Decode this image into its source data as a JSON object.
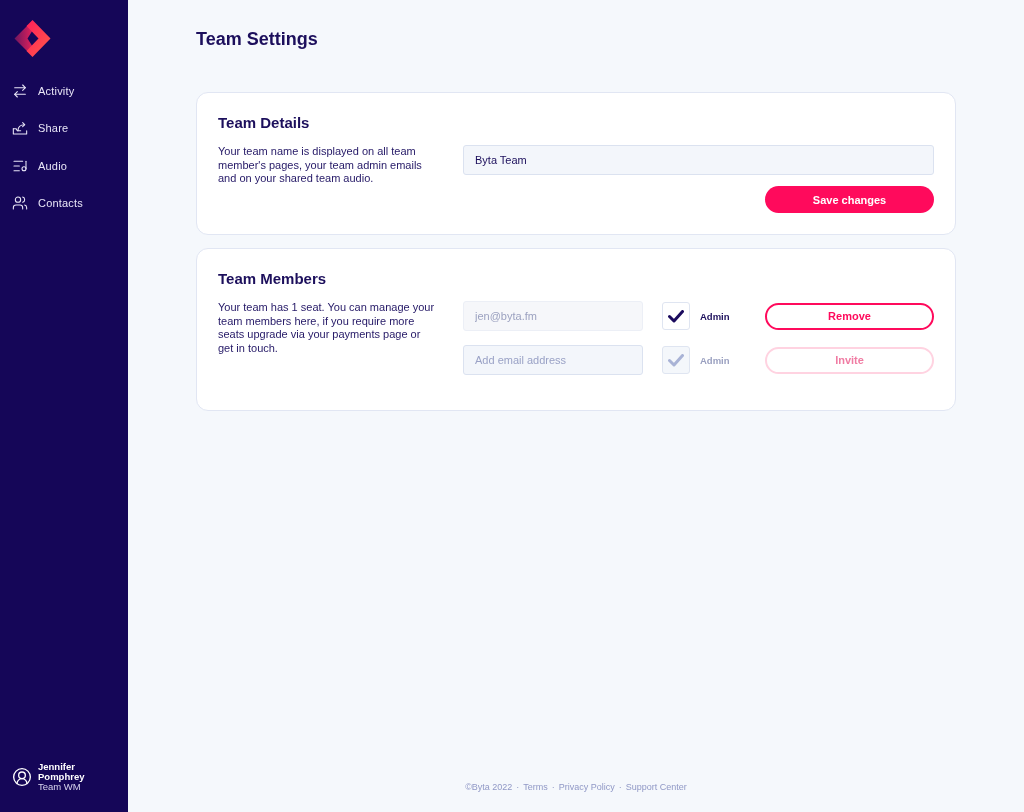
{
  "sidebar": {
    "nav_items": [
      {
        "label": "Activity",
        "selected": false
      },
      {
        "label": "Share",
        "selected": false
      },
      {
        "label": "Audio",
        "selected": false
      },
      {
        "label": "Contacts",
        "selected": false
      }
    ],
    "user": {
      "name": "Jennifer Pomphrey",
      "team": "Team WM"
    }
  },
  "page": {
    "title": "Team Settings"
  },
  "team_details": {
    "heading": "Team Details",
    "description": "Your team name is displayed on all team member's pages, your team admin emails and on your shared team audio.",
    "team_name_field": {
      "value": "Byta Team"
    },
    "save_button": {
      "label": "Save changes",
      "disabled": false
    }
  },
  "team_members": {
    "heading": "Team Members",
    "description": "Your team has 1 seat. You can manage your team members here, if you require more seats upgrade via your payments page or get in touch.",
    "rows": [
      {
        "field": {
          "value": "jen@byta.fm",
          "disabled": true
        },
        "checkbox": {
          "checked": true,
          "disabled": false
        },
        "admin_label": "Admin",
        "button": {
          "label": "Remove",
          "disabled": false
        }
      },
      {
        "field": {
          "placeholder": "Add email address",
          "disabled": false
        },
        "checkbox": {
          "checked": true,
          "disabled": true
        },
        "admin_label": "Admin",
        "button": {
          "label": "Invite",
          "disabled": true
        }
      }
    ]
  },
  "footer": {
    "copyright": "©Byta 2022",
    "separator": "·",
    "links": [
      "Terms",
      "Privacy Policy",
      "Support Center"
    ]
  }
}
